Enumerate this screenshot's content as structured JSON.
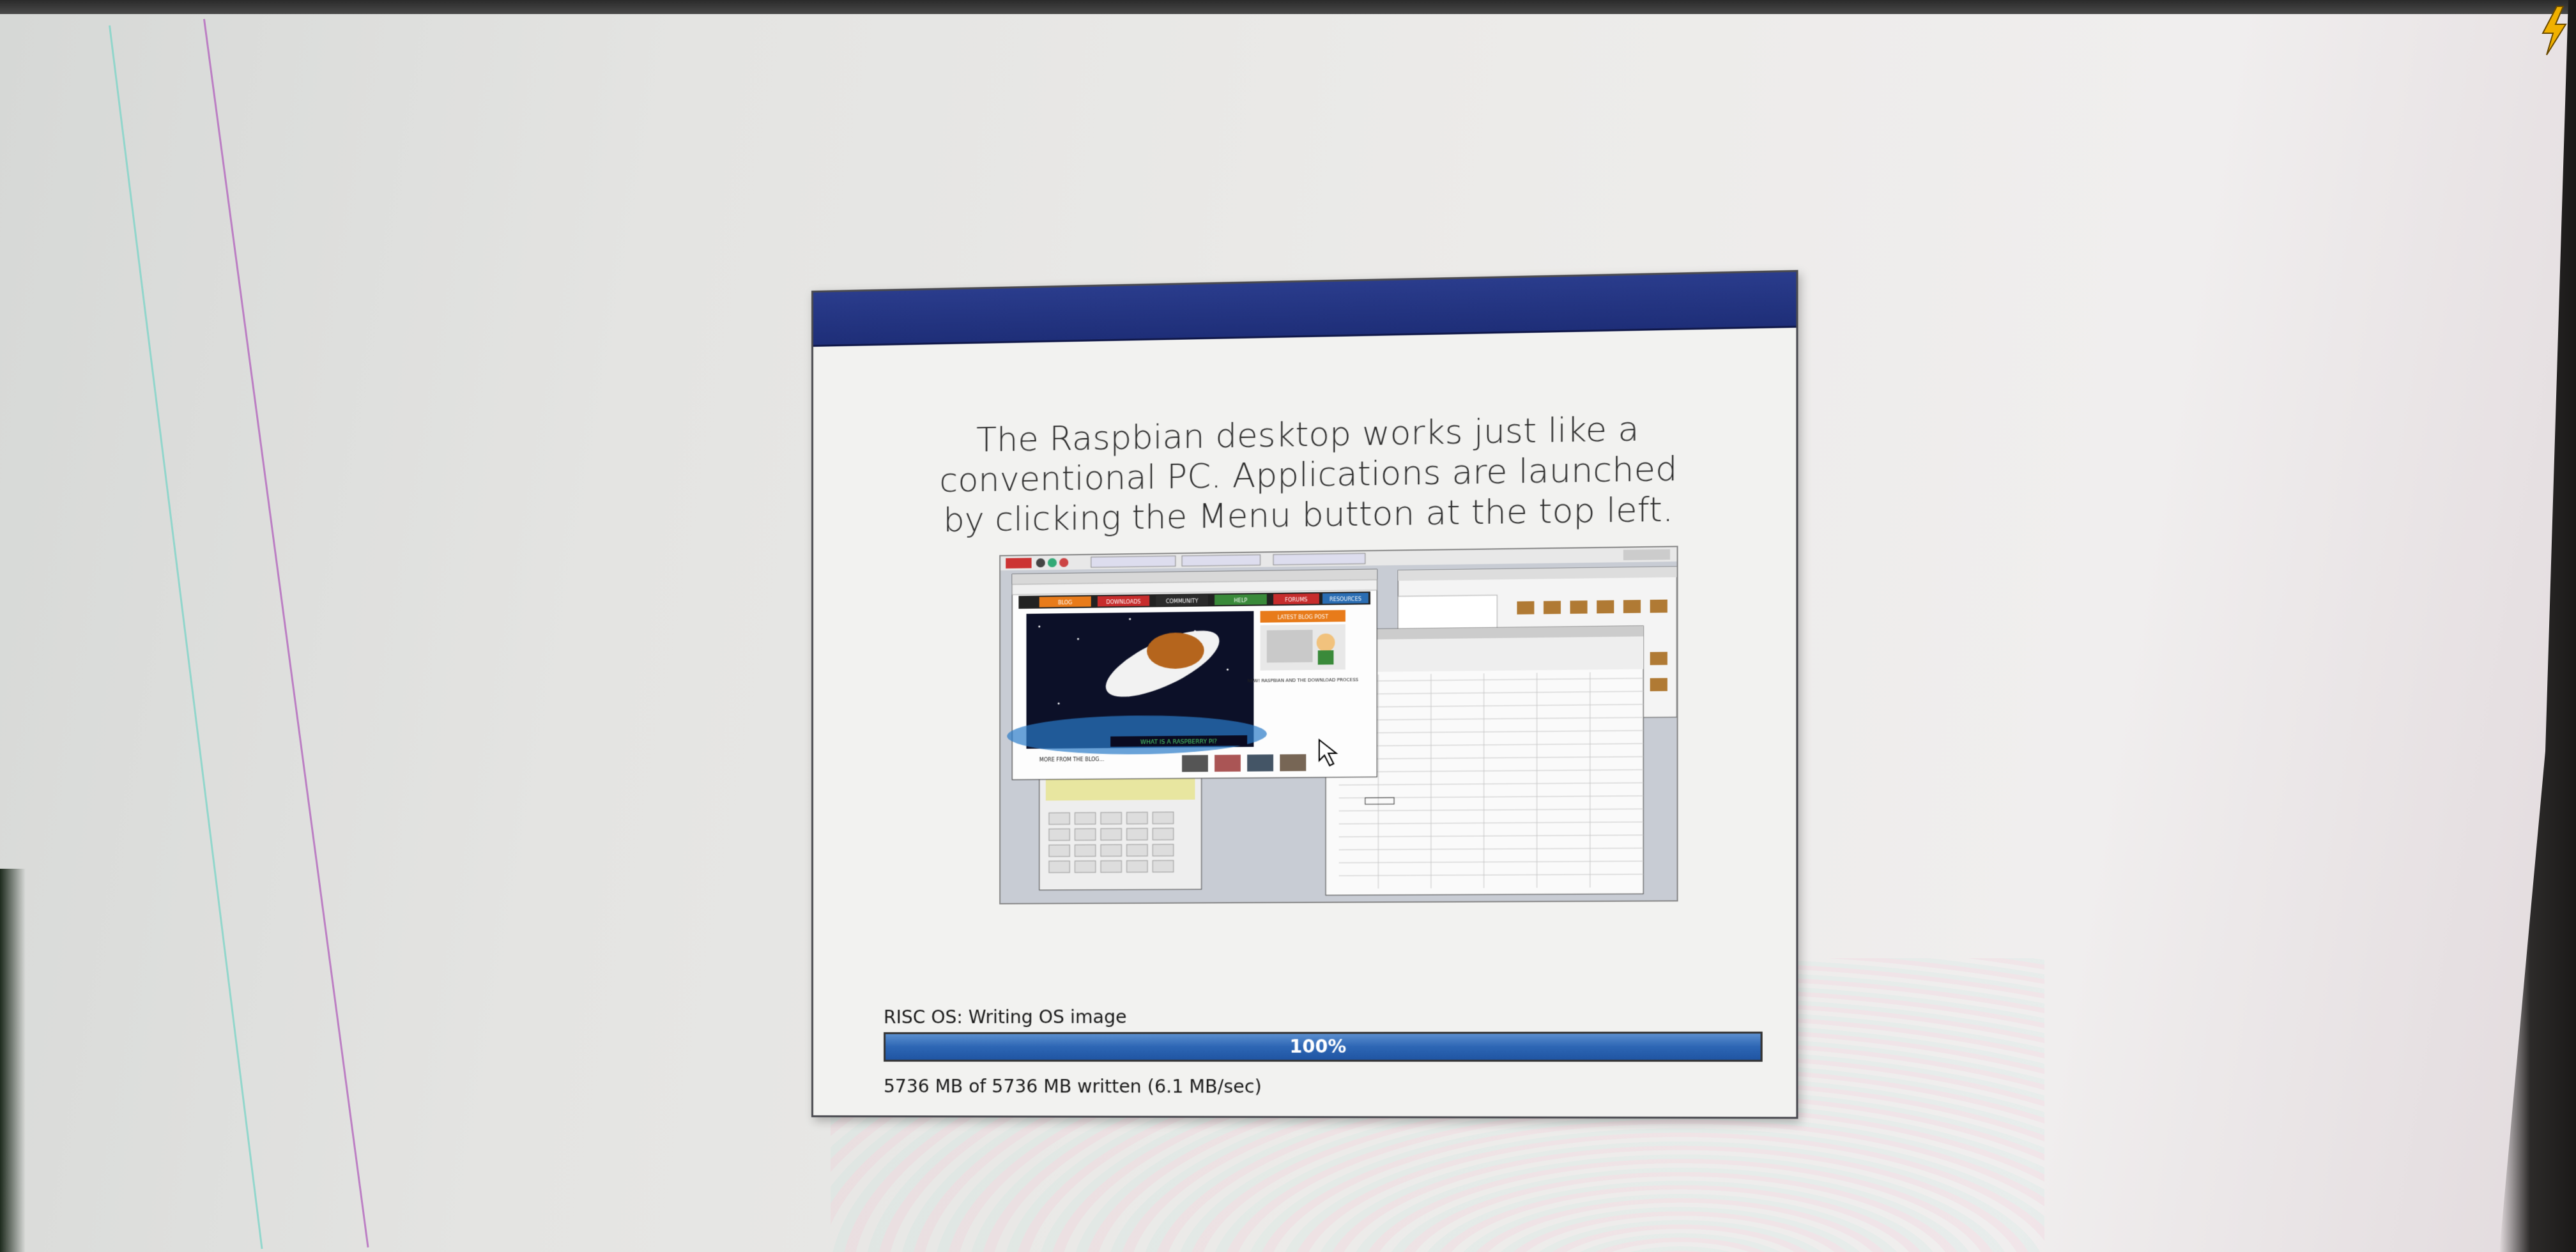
{
  "dialog": {
    "caption": "The Raspbian desktop works just like a conventional PC. Applications are launched by clicking the Menu button at the top left."
  },
  "screenshot_preview": {
    "browser_nav": [
      "BLOG",
      "DOWNLOADS",
      "COMMUNITY",
      "HELP",
      "FORUMS",
      "RESOURCES"
    ],
    "hero_caption": "WHAT IS A RASPBERRY PI?",
    "side_heading": "LATEST BLOG POST",
    "side_text": "NEW! RASPBIAN AND THE DOWNLOAD PROCESS",
    "footer_text": "MORE FROM THE BLOG..."
  },
  "progress": {
    "status": "RISC OS: Writing OS image",
    "percent": 100,
    "percent_label": "100%",
    "written": "5736 MB of 5736 MB written (6.1 MB/sec)"
  },
  "colors": {
    "titlebar": "#1e2e78",
    "progress_fill": "#2d66b4",
    "lightning": "#f0b000"
  },
  "icons": {
    "power_warning": "lightning-bolt-icon"
  }
}
